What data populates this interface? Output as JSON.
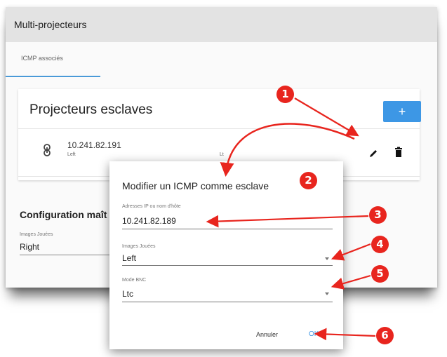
{
  "window": {
    "title": "Multi-projecteurs",
    "tab": "ICMP associés"
  },
  "slaves": {
    "title": "Projecteurs esclaves",
    "add_label": "+",
    "row": {
      "ip": "10.241.82.191",
      "images": "Left",
      "bnc": "Lt"
    }
  },
  "master_config": {
    "title": "Configuration maît",
    "images_label": "Images Jouées",
    "images_value": "Right"
  },
  "modal": {
    "title": "Modifier un ICMP comme esclave",
    "ip_label": "Adresses IP ou nom d'hôte",
    "ip_value": "10.241.82.189",
    "images_label": "Images Jouées",
    "images_value": "Left",
    "bnc_label": "Mode BNC",
    "bnc_value": "Ltc",
    "cancel_label": "Annuler",
    "ok_label": "OK"
  },
  "callouts": [
    "1",
    "2",
    "3",
    "4",
    "5",
    "6"
  ],
  "colors": {
    "accent": "#3d97e5",
    "callout": "#e8251e"
  }
}
